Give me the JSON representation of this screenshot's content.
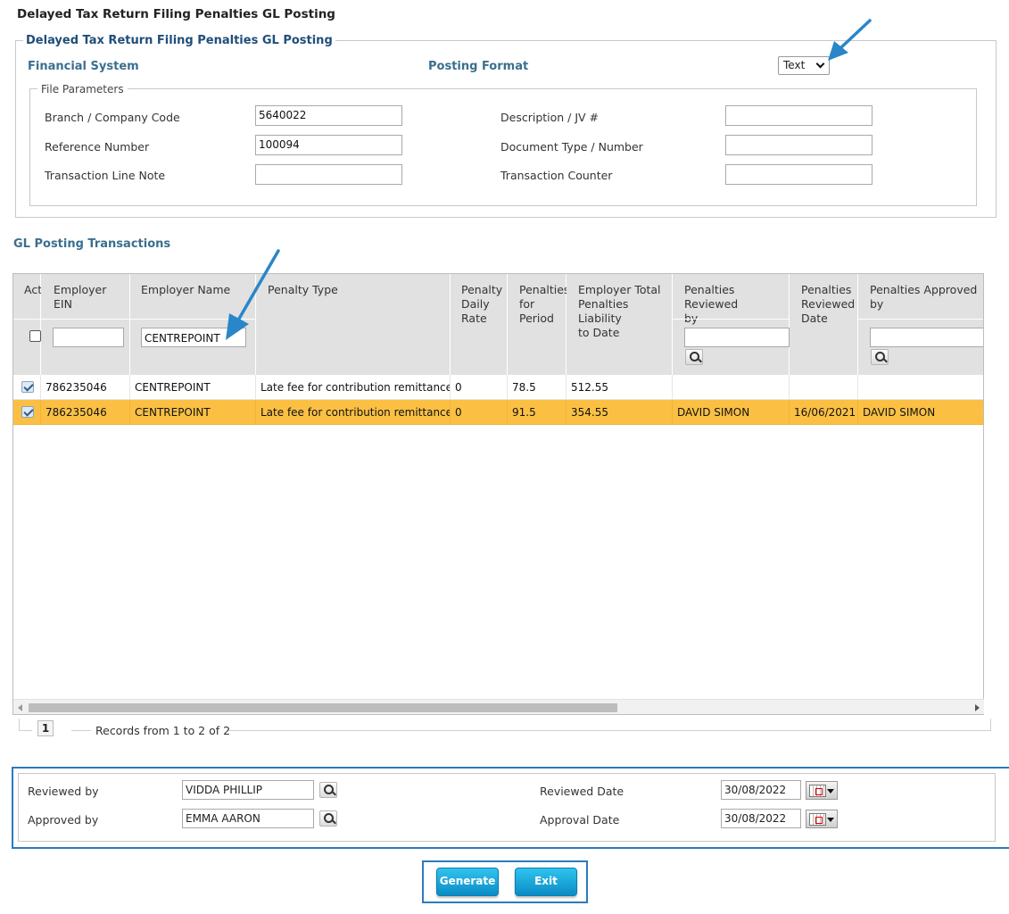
{
  "page": {
    "title": "Delayed Tax Return Filing Penalties GL Posting"
  },
  "posting": {
    "legend": "Delayed Tax Return Filing Penalties GL Posting",
    "financial_system_label": "Financial System",
    "posting_format_label": "Posting Format",
    "posting_format_value": "Text"
  },
  "file_params": {
    "legend": "File Parameters",
    "branch_label": "Branch / Company Code",
    "branch_value": "5640022",
    "reference_label": "Reference Number",
    "reference_value": "100094",
    "line_note_label": "Transaction Line Note",
    "line_note_value": "",
    "description_label": "Description / JV #",
    "description_value": "",
    "doc_type_label": "Document Type / Number",
    "doc_type_value": "",
    "counter_label": "Transaction Counter",
    "counter_value": ""
  },
  "gl": {
    "title": "GL Posting Transactions",
    "headers": {
      "act": "Act",
      "ein": "Employer EIN",
      "name": "Employer Name",
      "penalty_type": "Penalty Type",
      "daily_rate_1": "Penalty",
      "daily_rate_2": "Daily",
      "daily_rate_3": "Rate",
      "for_period_1": "Penalties",
      "for_period_2": "for",
      "for_period_3": "Period",
      "liability_1": "Employer Total",
      "liability_2": "Penalties Liability",
      "liability_3": "to Date",
      "reviewed_by_1": "Penalties Reviewed",
      "reviewed_by_2": "by",
      "reviewed_date_1": "Penalties",
      "reviewed_date_2": "Reviewed",
      "reviewed_date_3": "Date",
      "approved_by_1": "Penalties Approved",
      "approved_by_2": "by"
    },
    "filters": {
      "ein": "",
      "name": "CENTREPOINT",
      "reviewed_by": "",
      "approved_by": ""
    },
    "rows": [
      {
        "ein": "786235046",
        "name": "CENTREPOINT",
        "penalty_type": "Late fee for contribution remittance",
        "daily_rate": "0",
        "for_period": "78.5",
        "liability": "512.55",
        "reviewed_by": "",
        "reviewed_date": "",
        "approved_by": ""
      },
      {
        "ein": "786235046",
        "name": "CENTREPOINT",
        "penalty_type": "Late fee for contribution remittance",
        "daily_rate": "0",
        "for_period": "91.5",
        "liability": "354.55",
        "reviewed_by": "DAVID SIMON",
        "reviewed_date": "16/06/2021",
        "approved_by": "DAVID SIMON"
      }
    ],
    "page_number": "1",
    "records_text": "Records from 1 to 2 of 2"
  },
  "review": {
    "reviewed_by_label": "Reviewed by",
    "reviewed_by_value": "VIDDA PHILLIP",
    "approved_by_label": "Approved by",
    "approved_by_value": "EMMA AARON",
    "reviewed_date_label": "Reviewed Date",
    "reviewed_date_value": "30/08/2022",
    "approval_date_label": "Approval Date",
    "approval_date_value": "30/08/2022"
  },
  "actions": {
    "generate_label": "Generate",
    "exit_label": "Exit"
  },
  "colors": {
    "selected_row": "#fbc043",
    "accent_blue": "#2a7bbf",
    "section_title": "#3a6f8f"
  }
}
